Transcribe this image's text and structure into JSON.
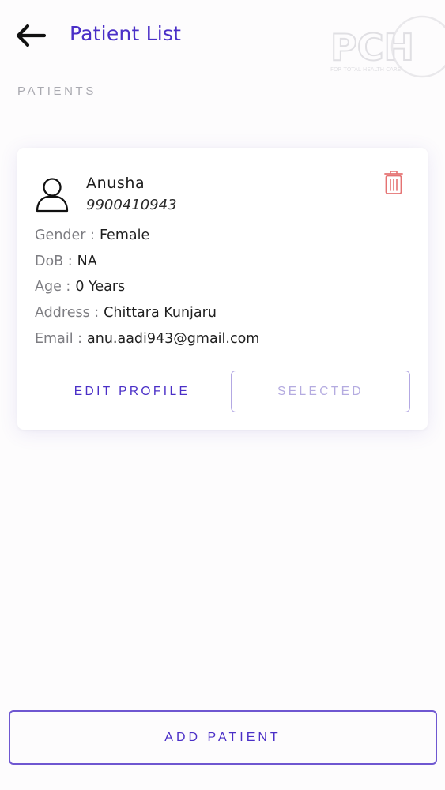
{
  "header": {
    "title": "Patient List",
    "back_icon": "arrow-left-icon",
    "logo_text": "PCH",
    "logo_tagline": "FOR TOTAL HEALTH CARE"
  },
  "section": {
    "label": "PATIENTS"
  },
  "patient": {
    "name": "Anusha",
    "phone": "9900410943",
    "delete_icon": "trash-icon",
    "fields": [
      {
        "label": "Gender :",
        "value": "Female"
      },
      {
        "label": "DoB :",
        "value": "NA"
      },
      {
        "label": "Age :",
        "value": "0 Years"
      },
      {
        "label": "Address :",
        "value": "Chittara Kunjaru"
      },
      {
        "label": "Email :",
        "value": "anu.aadi943@gmail.com"
      }
    ],
    "edit_label": "EDIT PROFILE",
    "selected_label": "SELECTED"
  },
  "footer": {
    "add_label": "ADD PATIENT"
  },
  "colors": {
    "accent": "#4a2fc7",
    "delete": "#e57373",
    "muted_label": "#a9a9b0"
  }
}
